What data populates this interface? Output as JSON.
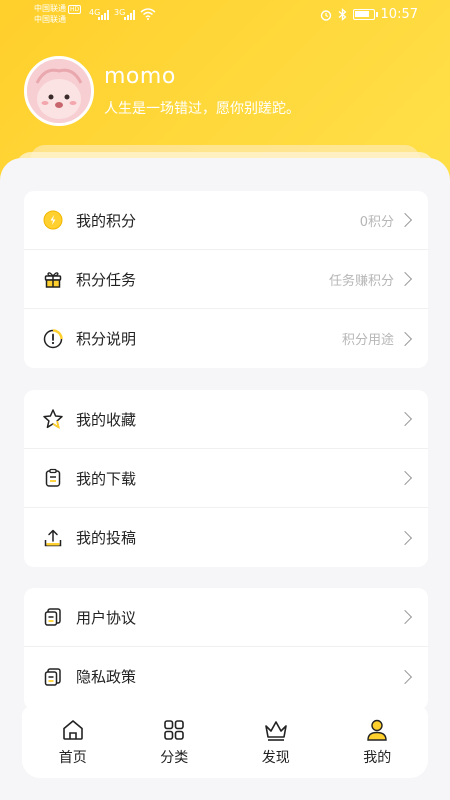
{
  "status_bar": {
    "carrier_1": "中国联通",
    "carrier_1_tag": "HD",
    "carrier_2": "中国联通",
    "signal_1": "4G",
    "signal_2": "3G",
    "time": "10:57"
  },
  "profile": {
    "username": "momo",
    "bio": "人生是一场错过，愿你别蹉跎。"
  },
  "points_card": {
    "items": [
      {
        "label": "我的积分",
        "value": "0积分",
        "icon": "points-coin-icon"
      },
      {
        "label": "积分任务",
        "value": "任务赚积分",
        "icon": "gift-icon"
      },
      {
        "label": "积分说明",
        "value": "积分用途",
        "icon": "info-clock-icon"
      }
    ]
  },
  "content_card": {
    "items": [
      {
        "label": "我的收藏",
        "icon": "star-icon"
      },
      {
        "label": "我的下载",
        "icon": "clipboard-icon"
      },
      {
        "label": "我的投稿",
        "icon": "upload-icon"
      }
    ]
  },
  "legal_card": {
    "items": [
      {
        "label": "用户协议",
        "icon": "document-icon"
      },
      {
        "label": "隐私政策",
        "icon": "document-icon"
      }
    ]
  },
  "bottom_nav": {
    "items": [
      {
        "label": "首页",
        "icon": "home-icon"
      },
      {
        "label": "分类",
        "icon": "grid-icon"
      },
      {
        "label": "发现",
        "icon": "crown-icon"
      },
      {
        "label": "我的",
        "icon": "user-icon",
        "active": true
      }
    ]
  },
  "colors": {
    "accent": "#FFD02E",
    "background": "#F6F6F8"
  }
}
